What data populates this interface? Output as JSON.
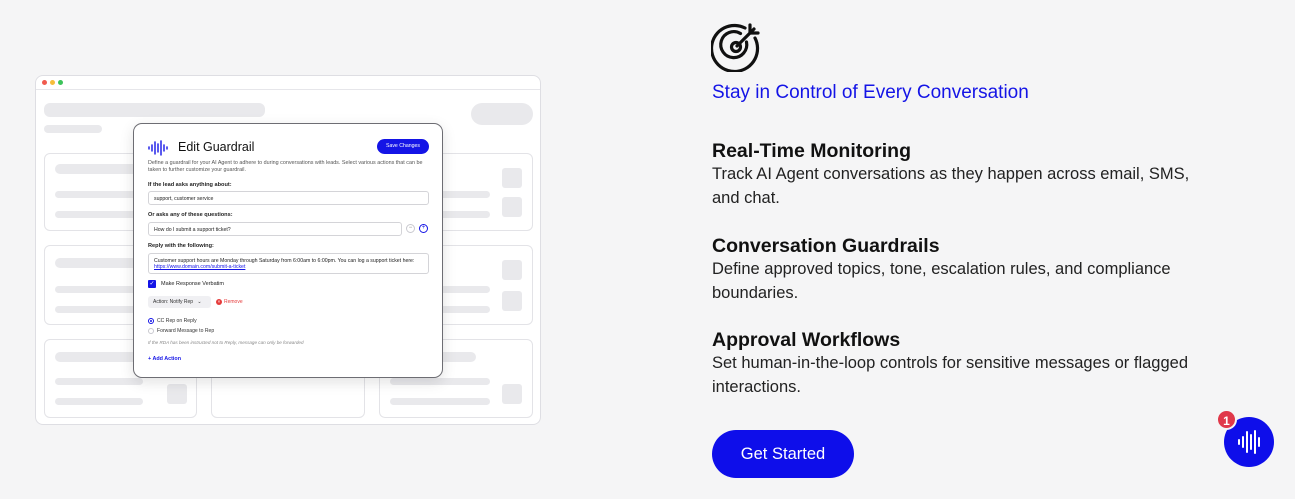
{
  "modal": {
    "title": "Edit Guardrail",
    "save_label": "Save Changes",
    "description": "Define a guardrail for your AI Agent to adhere to during conversations with leads. Select various actions that can be taken to further customize your guardrail.",
    "if_label": "If the lead asks anything about:",
    "if_value": "support, customer service",
    "or_label": "Or asks any of these questions:",
    "or_value": "How do I submit a support ticket?",
    "minus": "−",
    "plus": "+",
    "reply_label": "Reply with the following:",
    "reply_value": "Customer support hours are Monday through Saturday from 6:00am to 6:00pm. You can log a support ticket here:",
    "reply_link": "https://www.domain.com/submit-a-ticket",
    "verbatim_label": "Make Response Verbatim",
    "action_select": "Action: Notify Rep",
    "remove_label": "Remove",
    "radio_1": "CC Rep on Reply",
    "radio_2": "Forward Message to Rep",
    "note": "If the RDA has been instructed not to Reply, message can only be forwarded",
    "add_action": "+ Add Action"
  },
  "section": {
    "heading": "Stay in Control of Every Conversation",
    "features": [
      {
        "title": "Real-Time Monitoring",
        "description": "Track AI Agent conversations as they happen across email, SMS, and chat."
      },
      {
        "title": "Conversation Guardrails",
        "description": "Define approved topics, tone, escalation rules, and compliance boundaries."
      },
      {
        "title": "Approval Workflows",
        "description": "Set human-in-the-loop controls for sensitive messages or flagged interactions."
      }
    ],
    "cta_label": "Get Started"
  },
  "chat_widget": {
    "badge_count": "1",
    "icon": "soundwave-icon"
  },
  "icons": {
    "section_icon": "target-arrow-icon"
  },
  "colors": {
    "brand_blue": "#1414e6",
    "badge_red": "#e0384a",
    "background": "#f5f5f6"
  }
}
